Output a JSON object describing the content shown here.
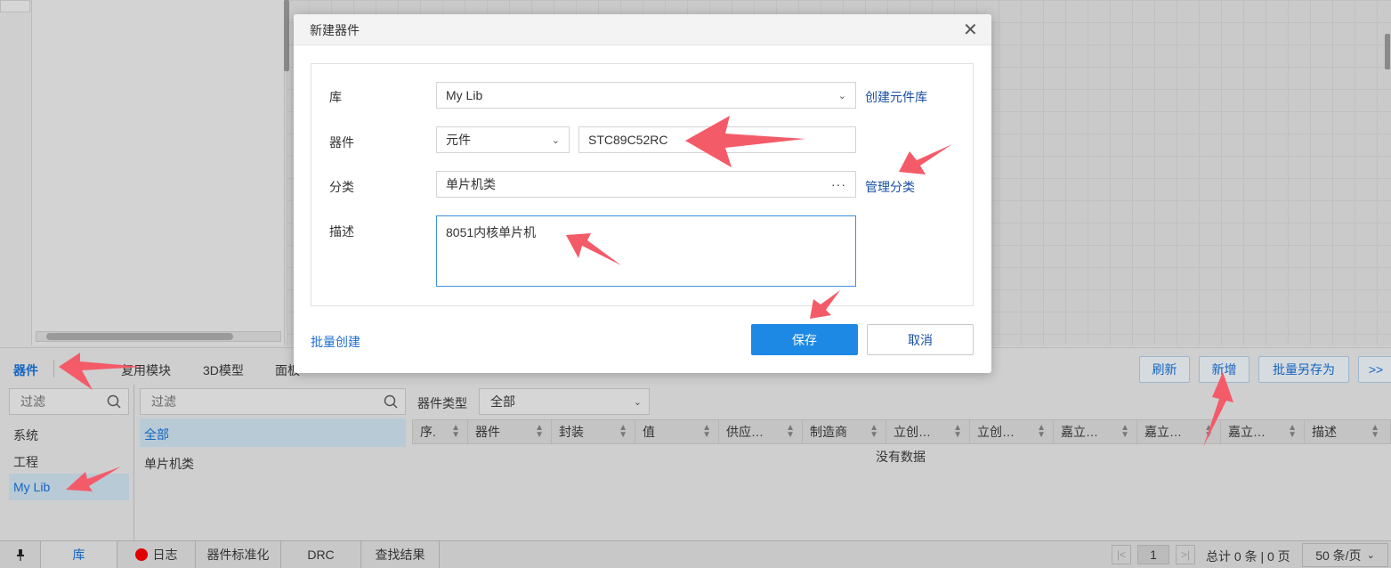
{
  "dialog": {
    "title": "新建器件",
    "library_label": "库",
    "library_value": "My Lib",
    "create_library_link": "创建元件库",
    "device_label": "器件",
    "device_type_value": "元件",
    "device_name_value": "STC89C52RC",
    "category_label": "分类",
    "category_value": "单片机类",
    "manage_category_link": "管理分类",
    "description_label": "描述",
    "description_value": "8051内核单片机",
    "batch_create_link": "批量创建",
    "save_label": "保存",
    "cancel_label": "取消"
  },
  "bottom": {
    "tabs": [
      "器件",
      "复用模块",
      "3D模型",
      "面板"
    ],
    "buttons": {
      "refresh": "刷新",
      "add": "新增",
      "batch_save_as": "批量另存为",
      "more": ">>"
    },
    "lib_filter_placeholder": "过滤",
    "libraries": [
      "系统",
      "工程",
      "My Lib"
    ],
    "category_filter_placeholder": "过滤",
    "categories": [
      "全部",
      "单片机类"
    ],
    "device_type_label": "器件类型",
    "device_type_value": "全部",
    "columns": [
      "序.",
      "器件",
      "封装",
      "值",
      "供应…",
      "制造商",
      "立创…",
      "立创…",
      "嘉立…",
      "嘉立…",
      "嘉立…",
      "描述"
    ],
    "empty_text": "没有数据"
  },
  "status_bar": {
    "pin_icon": "pin-icon",
    "tabs": [
      "库",
      "日志",
      "器件标准化",
      "DRC",
      "查找结果"
    ],
    "log_status_color": "#e00000",
    "page_current": "1",
    "total_text": "总计 0 条 | 0 页",
    "page_size": "50 条/页"
  },
  "colors": {
    "accent": "#1e88e5",
    "link": "#1a4fa3",
    "annotation_arrow": "#f45b69"
  }
}
